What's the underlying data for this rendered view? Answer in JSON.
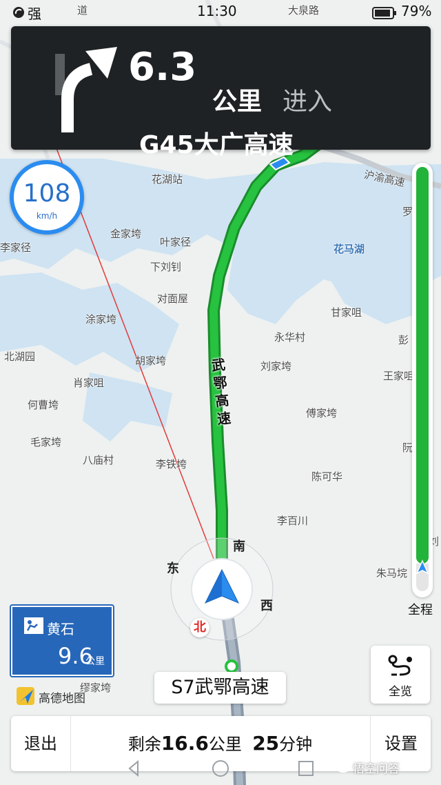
{
  "status": {
    "signal": "强",
    "time": "11:30",
    "battery": "79%"
  },
  "guidance": {
    "distance": "6.3",
    "unit": "公里",
    "action": "进入",
    "road": "G45大广高速"
  },
  "speed": {
    "value": "108",
    "unit": "km/h"
  },
  "map": {
    "route_label": "武鄂高速",
    "places": [
      {
        "name": "大泉路"
      },
      {
        "name": "花湖站"
      },
      {
        "name": "沪渝高速"
      },
      {
        "name": "罗"
      },
      {
        "name": "李家径"
      },
      {
        "name": "金家垮"
      },
      {
        "name": "叶家径"
      },
      {
        "name": "下刘钊"
      },
      {
        "name": "花马湖"
      },
      {
        "name": "对面屋"
      },
      {
        "name": "涂家垮"
      },
      {
        "name": "甘家咀"
      },
      {
        "name": "永华村"
      },
      {
        "name": "彭"
      },
      {
        "name": "北湖园"
      },
      {
        "name": "胡家垮"
      },
      {
        "name": "刘家垮"
      },
      {
        "name": "王家咀"
      },
      {
        "name": "肖家咀"
      },
      {
        "name": "何曹垮"
      },
      {
        "name": "傅家垮"
      },
      {
        "name": "毛家垮"
      },
      {
        "name": "八庙村"
      },
      {
        "name": "李铁垮"
      },
      {
        "name": "陈可华"
      },
      {
        "name": "李百川"
      },
      {
        "name": "朱马垸"
      },
      {
        "name": "缪家垮"
      },
      {
        "name": "阮"
      },
      {
        "name": "刘"
      },
      {
        "name": "道"
      }
    ]
  },
  "compass": {
    "north": "北",
    "south": "南",
    "east": "东",
    "west": "西"
  },
  "progress": {
    "label": "全程",
    "fraction": 0.93
  },
  "exit_sign": {
    "name": "黄石",
    "distance": "9.6",
    "unit": "公里"
  },
  "logo": {
    "text": "高德地图"
  },
  "current_road": "S7武鄂高速",
  "overview": {
    "label": "全览"
  },
  "bottom": {
    "exit": "退出",
    "remain_prefix": "剩余",
    "remain_distance": "16.6",
    "remain_unit": "公里",
    "remain_time": "25",
    "time_unit": "分钟",
    "settings": "设置"
  },
  "watermark": "悟空问答",
  "colors": {
    "route": "#22b33a",
    "panel": "#1f2224",
    "accent": "#2b8cf0",
    "exit_sign": "#2767b9"
  }
}
